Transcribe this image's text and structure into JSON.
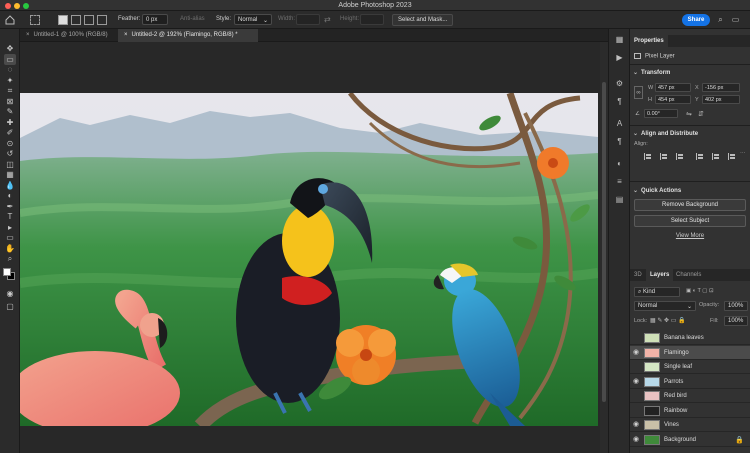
{
  "app": {
    "title": "Adobe Photoshop 2023"
  },
  "options_bar": {
    "feather_label": "Feather:",
    "feather_value": "0 px",
    "antialias_label": "Anti-alias",
    "style_label": "Style:",
    "style_value": "Normal",
    "width_label": "Width:",
    "height_label": "Height:",
    "select_mask_label": "Select and Mask...",
    "share_label": "Share"
  },
  "tabs": [
    {
      "label": "Untitled-1 @ 100% (RGB/8)"
    },
    {
      "label": "Untitled-2 @ 192% (Flamingo, RGB/8) *"
    }
  ],
  "toolbar": {
    "icons": [
      "move-icon",
      "marquee-icon",
      "lasso-icon",
      "object-select-icon",
      "crop-icon",
      "frame-icon",
      "eyedropper-icon",
      "healing-icon",
      "brush-icon",
      "stamp-icon",
      "history-brush-icon",
      "eraser-icon",
      "gradient-icon",
      "blur-icon",
      "dodge-icon",
      "pen-icon",
      "type-icon",
      "path-select-icon",
      "rectangle-icon",
      "hand-icon",
      "zoom-icon"
    ],
    "glyphs": [
      "✥",
      "▭",
      "◌",
      "✦",
      "⌗",
      "⊠",
      "✎",
      "✚",
      "✐",
      "⊙",
      "↺",
      "◫",
      "▦",
      "💧",
      "◐",
      "✒",
      "T",
      "▸",
      "▭",
      "✋",
      "⌕"
    ],
    "fg_color": "#ffffff",
    "bg_color": "#000000"
  },
  "properties": {
    "tab_label": "Properties",
    "kind": "Pixel Layer",
    "transform_label": "Transform",
    "w_label": "W",
    "w_value": "457 px",
    "x_label": "X",
    "x_value": "-156 px",
    "h_label": "H",
    "h_value": "454 px",
    "y_label": "Y",
    "y_value": "402 px",
    "angle_value": "0.00°",
    "align_label": "Align and Distribute",
    "align_sub": "Align:",
    "quick_actions_label": "Quick Actions",
    "remove_bg_label": "Remove Background",
    "select_subject_label": "Select Subject",
    "view_more_label": "View More"
  },
  "layers_panel": {
    "tabs": [
      "3D",
      "Layers",
      "Channels"
    ],
    "kind_label": "Kind",
    "blend_mode": "Normal",
    "opacity_label": "Opacity:",
    "opacity_value": "100%",
    "lock_label": "Lock:",
    "fill_label": "Fill:",
    "fill_value": "100%",
    "layers": [
      {
        "name": "Banana leaves",
        "visible": false,
        "selected": false,
        "thumb": "#cfe0b8"
      },
      {
        "name": "Flamingo",
        "visible": true,
        "selected": true,
        "thumb": "#f2b3a8"
      },
      {
        "name": "Single leaf",
        "visible": false,
        "selected": false,
        "thumb": "#d4e6c4"
      },
      {
        "name": "Parrots",
        "visible": true,
        "selected": false,
        "thumb": "#b7d8e8"
      },
      {
        "name": "Red bird",
        "visible": false,
        "selected": false,
        "thumb": "#e8c2c2"
      },
      {
        "name": "Rainbow",
        "visible": false,
        "selected": false,
        "thumb": "#222222"
      },
      {
        "name": "Vines",
        "visible": true,
        "selected": false,
        "thumb": "#c9c0a8"
      },
      {
        "name": "Background",
        "visible": true,
        "selected": false,
        "thumb": "#3f8a3a"
      }
    ]
  },
  "colors": {
    "accent": "#1473e6",
    "panel_bg": "#323232",
    "workspace_bg": "#282828"
  }
}
